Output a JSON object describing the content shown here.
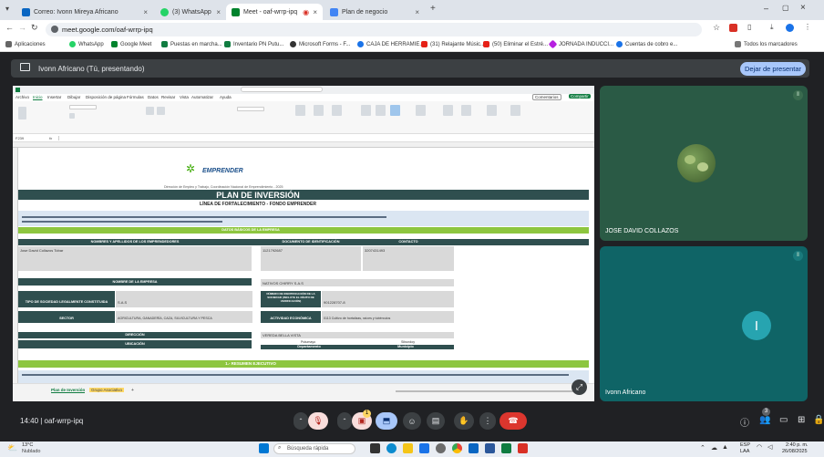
{
  "browser": {
    "tabs": [
      {
        "label": "Correo: Ivonn Mireya Africano",
        "icon_color": "#0a66c2",
        "active": false
      },
      {
        "label": "(3) WhatsApp",
        "icon_color": "#25d366",
        "active": false
      },
      {
        "label": "Meet - oaf-wrrp-ipq",
        "icon_color": "#00832d",
        "active": true
      },
      {
        "label": "Plan de negocio",
        "icon_color": "#4285f4",
        "active": false
      }
    ],
    "url": "meet.google.com/oaf-wrrp-ipq",
    "bookmarks": [
      "Aplicaciones",
      "WhatsApp",
      "Google Meet",
      "Puestas en marcha...",
      "Inventario PN Putu...",
      "Microsoft Forms - F...",
      "CAJA DE HERRAMIE...",
      "(31) Relajante Músic...",
      "(50) Eliminar el Estré...",
      "JORNADA INDUCCI...",
      "Cuentas de cobro e...",
      "Todos los marcadores"
    ]
  },
  "meet": {
    "presenting_label": "Ivonn Africano (Tú, presentando)",
    "stop_presenting_label": "Dejar de presentar",
    "participants": [
      {
        "name": "JOSE DAVID COLLAZOS"
      },
      {
        "name": "Ivonn Africano",
        "initial": "I"
      }
    ],
    "meeting_info": "14:40  |  oaf-wrrp-ipq",
    "people_count": "3",
    "hand_count": "1"
  },
  "excel": {
    "menu": [
      "Archivo",
      "Inicio",
      "Insertar",
      "Dibujar",
      "Disposición de página",
      "Fórmulas",
      "Datos",
      "Revisar",
      "Vista",
      "Automatizar",
      "Ayuda"
    ],
    "cell_ref": "F239",
    "share_label": "Compartir",
    "comments_label": "Comentarios",
    "brand": "EMPRENDER",
    "subtitle_top": "Dirección de Empleo y Trabajo, Coordinación Nacional de Emprendimiento - 2025",
    "title": "PLAN DE INVERSIÓN",
    "subtitle": "LÍNEA DE FORTALECIMIENTO - FONDO EMPRENDER",
    "section_basic": "DATOS BÁSICOS DE LA EMPRESA",
    "col_names": "NOMBRES Y APELLIDOS DE LOS EMPRENDEDORES",
    "col_doc": "DOCUMENTO DE IDENTIFICACIÓN",
    "col_contact": "CONTACTO",
    "owner_name": "Jose David Collazos Tobar",
    "owner_doc": "1121792687",
    "owner_contact": "3207431493",
    "company_label": "NOMBRE DE LA EMPRESA",
    "company_value": "NATIVOS CHIRRY S.A.S",
    "society_label": "TIPO DE SOCIEDAD LEGALMENTE CONSTITUIDA",
    "society_value": "S.A.S",
    "nit_label": "NÚMERO DE IDENTIFICACIÓN DE LA SOCIEDAD (INCLUYE EL DÍGITO DE VERIFICACIÓN)",
    "nit_value": "901228707-8",
    "sector_label": "SECTOR",
    "sector_value": "AGRICULTURA, GANADERÍA, CAZA, SILVICULTURA Y PESCA",
    "activity_label": "ACTIVIDAD ECONÓMICA",
    "activity_value": "0113 Cultivo de hortalizas, raíces y tubérculos",
    "address_label": "DIRECCIÓN",
    "address_value": "VEREDA BELLA VISTA",
    "location_label": "UBICACIÓN",
    "dept_label": "Departamento",
    "mun_label": "Municipio",
    "dept_value": "Putumayo",
    "mun_value": "Sibundoy",
    "summary_label": "1.- RESUMEN EJECUTIVO",
    "sheet_tabs": [
      "Plan de Inversión",
      "Grupo Asociativo"
    ]
  },
  "taskbar": {
    "weather_temp": "13°C",
    "weather_desc": "Nublado",
    "search_placeholder": "Búsqueda rápida",
    "lang": "ESP",
    "lang2": "LAA",
    "time": "2:40 p. m.",
    "date": "26/08/2025"
  }
}
